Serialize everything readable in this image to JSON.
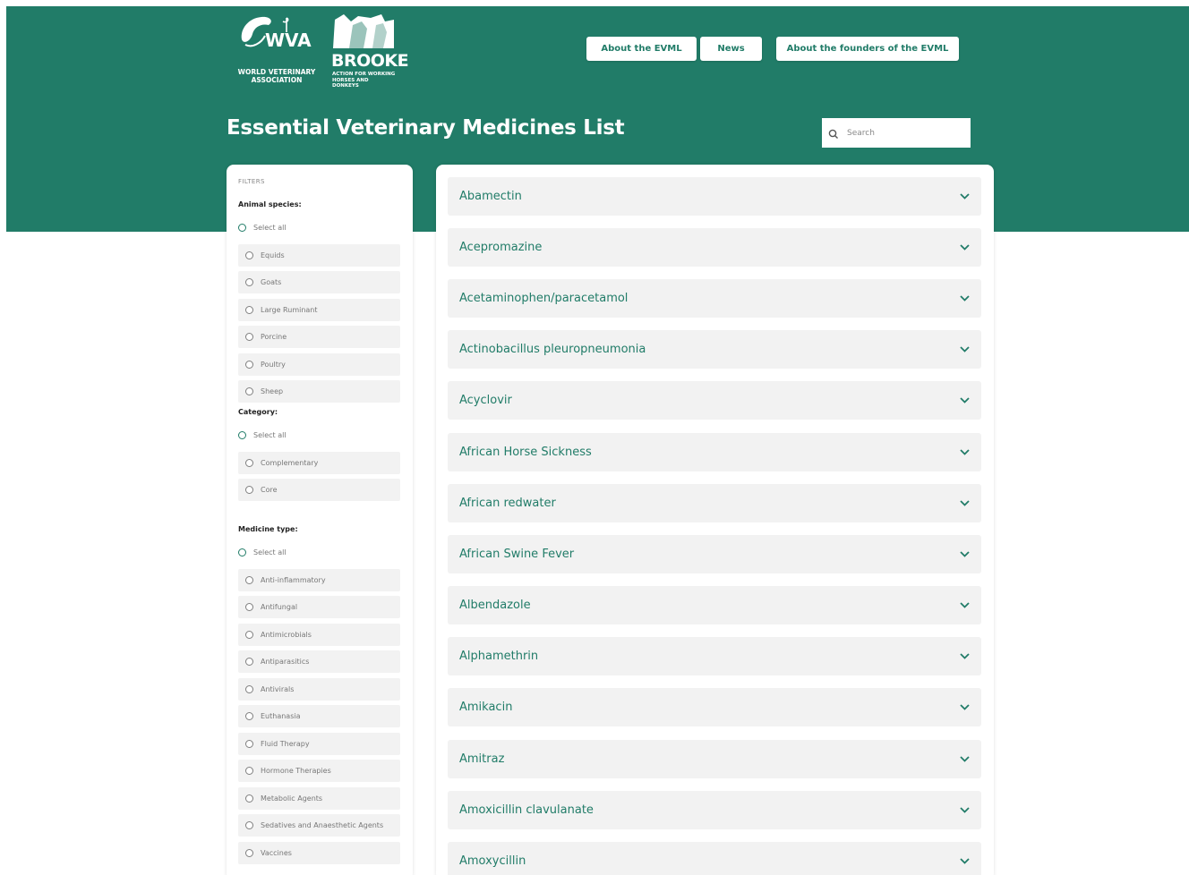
{
  "header": {
    "wva_logo_text": "WORLD VETERINARY ASSOCIATION",
    "brooke_wordmark": "BROOKE",
    "brooke_tagline": "ACTION FOR WORKING HORSES AND DONKEYS",
    "nav": {
      "about": "About the EVML",
      "news": "News",
      "founders": "About the founders of the EVML"
    },
    "title": "Essential Veterinary Medicines List",
    "search_placeholder": "Search"
  },
  "filters": {
    "heading": "FILTERS",
    "animal_species": {
      "title": "Animal species:",
      "select_all": "Select all",
      "options": [
        "Equids",
        "Goats",
        "Large Ruminant",
        "Porcine",
        "Poultry",
        "Sheep"
      ]
    },
    "category": {
      "title": "Category:",
      "select_all": "Select all",
      "options": [
        "Complementary",
        "Core"
      ]
    },
    "medicine_type": {
      "title": "Medicine type:",
      "select_all": "Select all",
      "options": [
        "Anti-inflammatory",
        "Antifungal",
        "Antimicrobials",
        "Antiparasitics",
        "Antivirals",
        "Euthanasia",
        "Fluid Therapy",
        "Hormone Therapies",
        "Metabolic Agents",
        "Sedatives and Anaesthetic Agents",
        "Vaccines"
      ]
    }
  },
  "medicines": [
    "Abamectin",
    "Acepromazine",
    "Acetaminophen/paracetamol",
    "Actinobacillus pleuropneumonia",
    "Acyclovir",
    "African Horse Sickness",
    "African redwater",
    "African Swine Fever",
    "Albendazole",
    "Alphamethrin",
    "Amikacin",
    "Amitraz",
    "Amoxicillin clavulanate",
    "Amoxycillin"
  ],
  "colors": {
    "brand_green": "#217c68",
    "item_bg": "#f2f2f2"
  },
  "icons": {
    "search": "search-icon",
    "expand": "chevron-down-icon"
  }
}
